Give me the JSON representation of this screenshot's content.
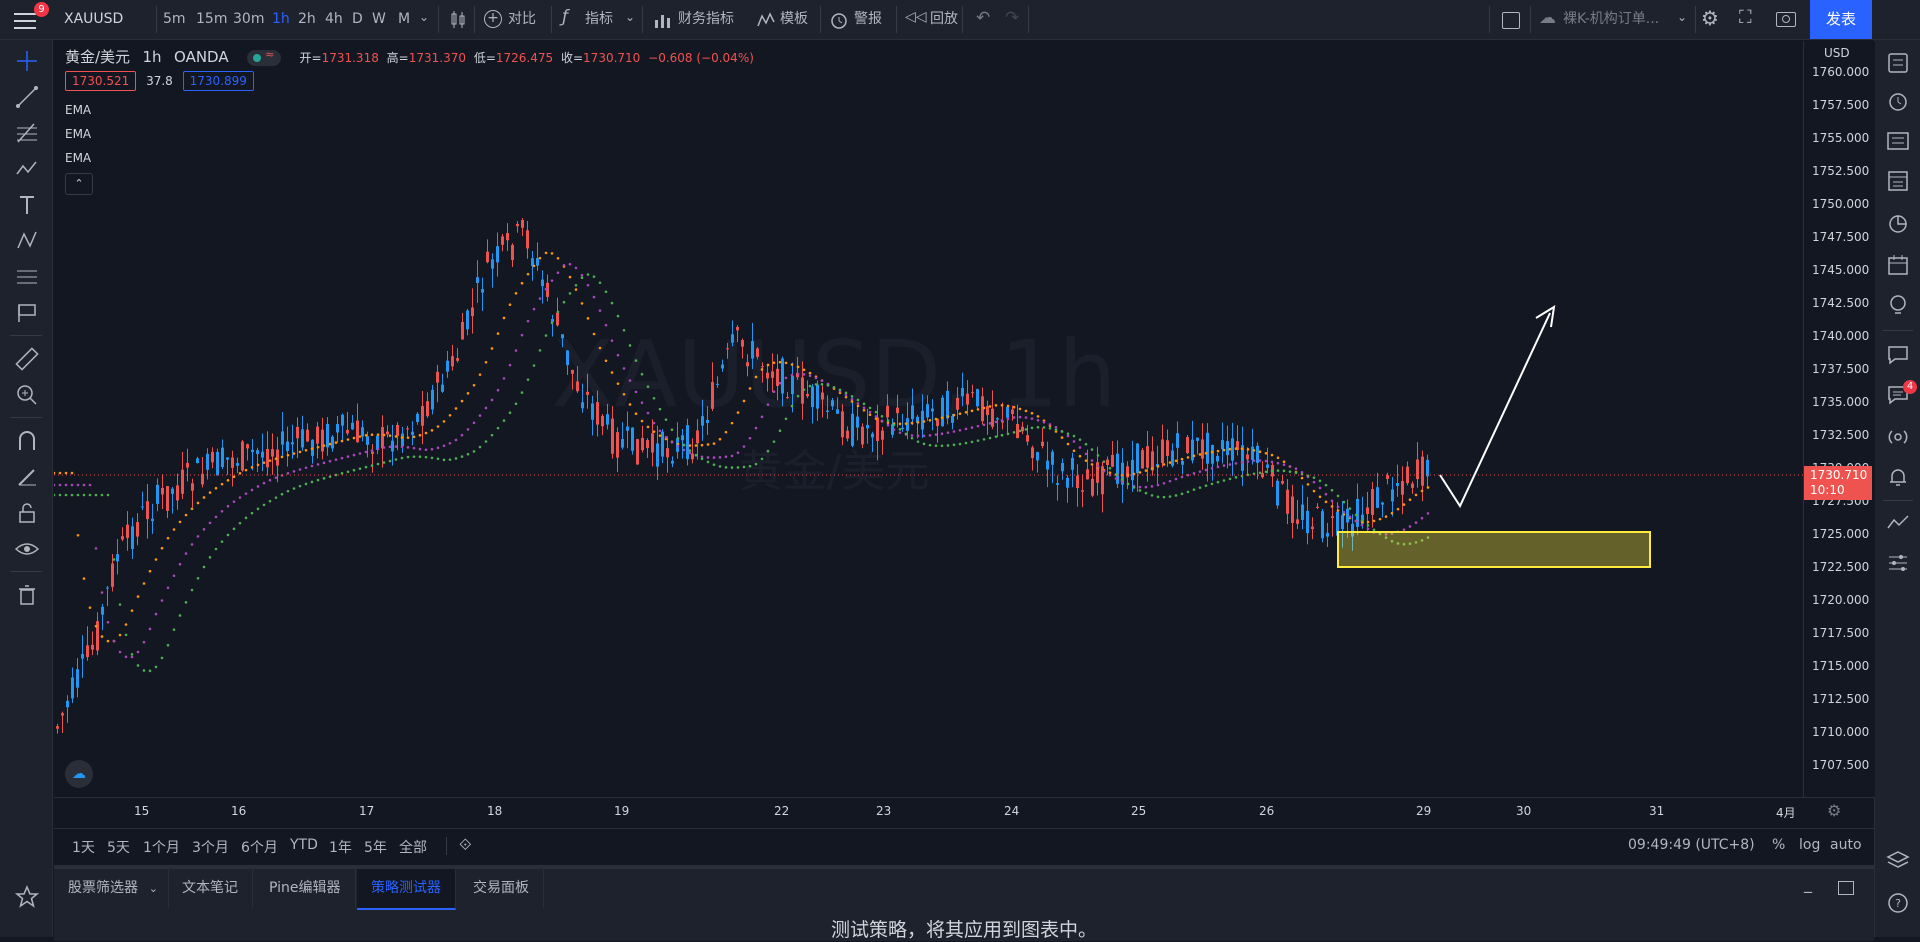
{
  "topbar": {
    "badge_count": "9",
    "symbol": "XAUUSD",
    "intervals": [
      "5m",
      "15m",
      "30m",
      "1h",
      "2h",
      "4h",
      "D",
      "W",
      "M"
    ],
    "active_interval": "1h",
    "compare_label": "对比",
    "indicators_label": "指标",
    "financials_label": "财务指标",
    "templates_label": "模板",
    "alert_label": "警报",
    "replay_label": "回放",
    "layout_name": "裸K-机构订单...",
    "publish_label": "发表"
  },
  "legend": {
    "title": "黄金/美元",
    "interval": "1h",
    "exchange": "OANDA",
    "open_label": "开=",
    "open": "1731.318",
    "high_label": "高=",
    "high": "1731.370",
    "low_label": "低=",
    "low": "1726.475",
    "close_label": "收=",
    "close": "1730.710",
    "change": "−0.608 (−0.04%)",
    "bid": "1730.521",
    "spread": "37.8",
    "ask": "1730.899",
    "ema1": "EMA",
    "ema2": "EMA",
    "ema3": "EMA"
  },
  "watermark": {
    "symbol": "XAUUSD, 1h",
    "name": "黄金/美元"
  },
  "price_axis": {
    "currency": "USD",
    "labels": [
      "1760.000",
      "1757.500",
      "1755.000",
      "1752.500",
      "1750.000",
      "1747.500",
      "1745.000",
      "1742.500",
      "1740.000",
      "1737.500",
      "1735.000",
      "1732.500",
      "1730.000",
      "1727.500",
      "1725.000",
      "1722.500",
      "1720.000",
      "1717.500",
      "1715.000",
      "1712.500",
      "1710.000",
      "1707.500"
    ],
    "current_price": "1730.710",
    "countdown": "10:10"
  },
  "time_axis": {
    "labels": [
      "15",
      "16",
      "17",
      "18",
      "19",
      "22",
      "23",
      "24",
      "25",
      "26",
      "29",
      "30",
      "31",
      "4月"
    ]
  },
  "range_bar": {
    "ranges": [
      "1天",
      "5天",
      "1个月",
      "3个月",
      "6个月",
      "YTD",
      "1年",
      "5年",
      "全部"
    ],
    "clock": "09:49:49 (UTC+8)",
    "percent": "%",
    "log": "log",
    "auto": "auto"
  },
  "panel": {
    "tabs": [
      "股票筛选器",
      "文本笔记",
      "Pine编辑器",
      "策略测试器",
      "交易面板"
    ],
    "active_tab": "策略测试器",
    "message": "测试策略，将其应用到图表中。"
  },
  "right_toolbar": {
    "notif_count": "4"
  },
  "colors": {
    "up": "#2196f3",
    "down": "#ef5350",
    "ema_fast": "#ff9800",
    "ema_mid": "#ab47bc",
    "ema_slow": "#4caf50",
    "zone": "#ffeb3b",
    "accent": "#2962ff"
  }
}
